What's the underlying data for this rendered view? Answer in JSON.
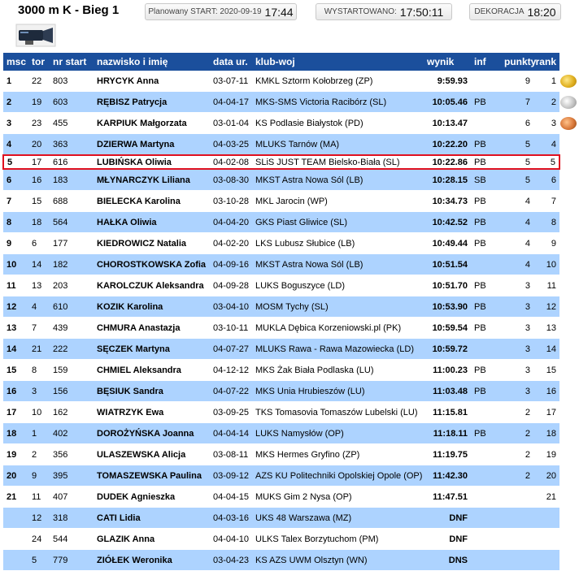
{
  "header": {
    "title": "3000 m K - Bieg 1",
    "planned_label": "Planowany START: 2020-09-19",
    "planned_time": "17:44",
    "started_label": "WYSTARTOWANO:",
    "started_time": "17:50:11",
    "decoration_label": "DEKORACJA",
    "decoration_time": "18:20"
  },
  "colors": {
    "header_bg": "#1b4f9c",
    "row_alt": "#add3ff",
    "highlight_border": "#e0101f"
  },
  "columns": [
    "msc",
    "tor",
    "nr start",
    "nazwisko i imię",
    "data ur.",
    "klub-woj",
    "wynik",
    "inf",
    "punkty",
    "rank"
  ],
  "rows": [
    {
      "msc": "1",
      "tor": "22",
      "nr": "803",
      "name": "HRYCYK Anna",
      "dob": "03-07-11",
      "club": "KMKL Sztorm Kołobrzeg (ZP)",
      "result": "9:59.93",
      "inf": "",
      "pts": "9",
      "rank": "1",
      "medal": "gold"
    },
    {
      "msc": "2",
      "tor": "19",
      "nr": "603",
      "name": "RĘBISZ Patrycja",
      "dob": "04-04-17",
      "club": "MKS-SMS Victoria Racibórz (SL)",
      "result": "10:05.46",
      "inf": "PB",
      "pts": "7",
      "rank": "2",
      "medal": "silver"
    },
    {
      "msc": "3",
      "tor": "23",
      "nr": "455",
      "name": "KARPIUK Małgorzata",
      "dob": "03-01-04",
      "club": "KS Podlasie Białystok (PD)",
      "result": "10:13.47",
      "inf": "",
      "pts": "6",
      "rank": "3",
      "medal": "bronze"
    },
    {
      "msc": "4",
      "tor": "20",
      "nr": "363",
      "name": "DZIERWA Martyna",
      "dob": "04-03-25",
      "club": "MLUKS Tarnów (MA)",
      "result": "10:22.20",
      "inf": "PB",
      "pts": "5",
      "rank": "4"
    },
    {
      "msc": "5",
      "tor": "17",
      "nr": "616",
      "name": "LUBIŃSKA Oliwia",
      "dob": "04-02-08",
      "club": "SLiS JUST TEAM Bielsko-Biała (SL)",
      "result": "10:22.86",
      "inf": "PB",
      "pts": "5",
      "rank": "5",
      "highlight": true
    },
    {
      "msc": "6",
      "tor": "16",
      "nr": "183",
      "name": "MŁYNARCZYK Liliana",
      "dob": "03-08-30",
      "club": "MKST Astra Nowa Sól (LB)",
      "result": "10:28.15",
      "inf": "SB",
      "pts": "5",
      "rank": "6"
    },
    {
      "msc": "7",
      "tor": "15",
      "nr": "688",
      "name": "BIELECKA Karolina",
      "dob": "03-10-28",
      "club": "MKL Jarocin (WP)",
      "result": "10:34.73",
      "inf": "PB",
      "pts": "4",
      "rank": "7"
    },
    {
      "msc": "8",
      "tor": "18",
      "nr": "564",
      "name": "HAŁKA Oliwia",
      "dob": "04-04-20",
      "club": "GKS Piast Gliwice (SL)",
      "result": "10:42.52",
      "inf": "PB",
      "pts": "4",
      "rank": "8"
    },
    {
      "msc": "9",
      "tor": "6",
      "nr": "177",
      "name": "KIEDROWICZ Natalia",
      "dob": "04-02-20",
      "club": "LKS Lubusz Słubice (LB)",
      "result": "10:49.44",
      "inf": "PB",
      "pts": "4",
      "rank": "9"
    },
    {
      "msc": "10",
      "tor": "14",
      "nr": "182",
      "name": "CHOROSTKOWSKA Zofia",
      "dob": "04-09-16",
      "club": "MKST Astra Nowa Sól (LB)",
      "result": "10:51.54",
      "inf": "",
      "pts": "4",
      "rank": "10"
    },
    {
      "msc": "11",
      "tor": "13",
      "nr": "203",
      "name": "KAROLCZUK Aleksandra",
      "dob": "04-09-28",
      "club": "LUKS Boguszyce (LD)",
      "result": "10:51.70",
      "inf": "PB",
      "pts": "3",
      "rank": "11"
    },
    {
      "msc": "12",
      "tor": "4",
      "nr": "610",
      "name": "KOZIK Karolina",
      "dob": "03-04-10",
      "club": "MOSM Tychy (SL)",
      "result": "10:53.90",
      "inf": "PB",
      "pts": "3",
      "rank": "12"
    },
    {
      "msc": "13",
      "tor": "7",
      "nr": "439",
      "name": "CHMURA Anastazja",
      "dob": "03-10-11",
      "club": "MUKLA Dębica Korzeniowski.pl (PK)",
      "result": "10:59.54",
      "inf": "PB",
      "pts": "3",
      "rank": "13"
    },
    {
      "msc": "14",
      "tor": "21",
      "nr": "222",
      "name": "SĘCZEK Martyna",
      "dob": "04-07-27",
      "club": "MLUKS Rawa - Rawa Mazowiecka (LD)",
      "result": "10:59.72",
      "inf": "",
      "pts": "3",
      "rank": "14"
    },
    {
      "msc": "15",
      "tor": "8",
      "nr": "159",
      "name": "CHMIEL Aleksandra",
      "dob": "04-12-12",
      "club": "MKS Żak Biała Podlaska (LU)",
      "result": "11:00.23",
      "inf": "PB",
      "pts": "3",
      "rank": "15"
    },
    {
      "msc": "16",
      "tor": "3",
      "nr": "156",
      "name": "BĘSIUK Sandra",
      "dob": "04-07-22",
      "club": "MKS Unia Hrubieszów (LU)",
      "result": "11:03.48",
      "inf": "PB",
      "pts": "3",
      "rank": "16"
    },
    {
      "msc": "17",
      "tor": "10",
      "nr": "162",
      "name": "WIATRZYK Ewa",
      "dob": "03-09-25",
      "club": "TKS Tomasovia Tomaszów Lubelski (LU)",
      "result": "11:15.81",
      "inf": "",
      "pts": "2",
      "rank": "17"
    },
    {
      "msc": "18",
      "tor": "1",
      "nr": "402",
      "name": "DOROŻYŃSKA Joanna",
      "dob": "04-04-14",
      "club": "LUKS Namysłów (OP)",
      "result": "11:18.11",
      "inf": "PB",
      "pts": "2",
      "rank": "18"
    },
    {
      "msc": "19",
      "tor": "2",
      "nr": "356",
      "name": "ULASZEWSKA Alicja",
      "dob": "03-08-11",
      "club": "MKS Hermes Gryfino (ZP)",
      "result": "11:19.75",
      "inf": "",
      "pts": "2",
      "rank": "19"
    },
    {
      "msc": "20",
      "tor": "9",
      "nr": "395",
      "name": "TOMASZEWSKA Paulina",
      "dob": "03-09-12",
      "club": "AZS KU Politechniki Opolskiej Opole (OP)",
      "result": "11:42.30",
      "inf": "",
      "pts": "2",
      "rank": "20"
    },
    {
      "msc": "21",
      "tor": "11",
      "nr": "407",
      "name": "DUDEK Agnieszka",
      "dob": "04-04-15",
      "club": "MUKS Gim 2 Nysa (OP)",
      "result": "11:47.51",
      "inf": "",
      "pts": "",
      "rank": "21"
    },
    {
      "msc": "",
      "tor": "12",
      "nr": "318",
      "name": "CATI Lidia",
      "dob": "04-03-16",
      "club": "UKS 48 Warszawa (MZ)",
      "result": "DNF",
      "inf": "",
      "pts": "",
      "rank": ""
    },
    {
      "msc": "",
      "tor": "24",
      "nr": "544",
      "name": "GLAZIK Anna",
      "dob": "04-04-10",
      "club": "ULKS Talex Borzytuchom (PM)",
      "result": "DNF",
      "inf": "",
      "pts": "",
      "rank": ""
    },
    {
      "msc": "",
      "tor": "5",
      "nr": "779",
      "name": "ZIÓŁEK Weronika",
      "dob": "03-04-23",
      "club": "KS AZS UWM Olsztyn (WN)",
      "result": "DNS",
      "inf": "",
      "pts": "",
      "rank": ""
    }
  ]
}
